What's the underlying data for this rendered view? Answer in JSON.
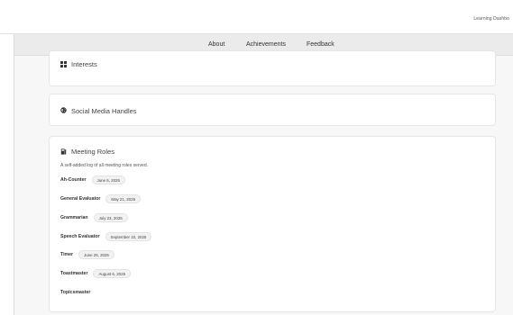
{
  "topbar": {
    "link": "Learning Dashbo"
  },
  "tabs": [
    {
      "label": "About"
    },
    {
      "label": "Achievements"
    },
    {
      "label": "Feedback"
    }
  ],
  "active_tab": "About",
  "colors": {
    "accent": "#8a1b2d"
  },
  "sections": {
    "interests": {
      "title": "Interests",
      "icon": "grid-icon"
    },
    "social": {
      "title": "Social Media Handles",
      "icon": "globe-icon"
    },
    "roles": {
      "title": "Meeting Roles",
      "icon": "book-icon",
      "subtitle": "A self-added log of all meeting roles served.",
      "items": [
        {
          "role": "Ah-Counter",
          "date": "June 6, 2025"
        },
        {
          "role": "General Evaluator",
          "date": "May 21, 2025"
        },
        {
          "role": "Grammarian",
          "date": "July 23, 2025"
        },
        {
          "role": "Speech Evaluator",
          "date": "September 10, 2025"
        },
        {
          "role": "Timer",
          "date": "June 25, 2025"
        },
        {
          "role": "Toastmaster",
          "date": "August 6, 2025"
        },
        {
          "role": "Topicsmaster",
          "date": ""
        }
      ]
    }
  }
}
